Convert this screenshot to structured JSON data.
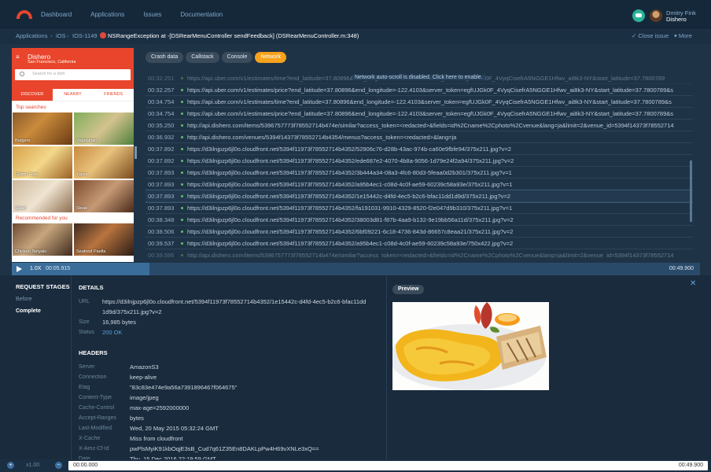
{
  "nav": {
    "links": [
      "Dashboard",
      "Applications",
      "Issues",
      "Documentation"
    ],
    "user_name": "Dmitry Fink",
    "user_org": "Dishero"
  },
  "breadcrumb": {
    "items": [
      "Applications",
      "iOS",
      "IOS-1149"
    ],
    "title": "NSRangeException at -[DSRearMenuController sendFeedback] (DSRearMenuController.m:348)",
    "close_issue": "✓ Close issue",
    "more": "▾ More"
  },
  "phone": {
    "app_title": "Dishero",
    "location": "San Francisco, California",
    "search_placeholder": "Search for a dish",
    "tabs": [
      "DISCOVER",
      "NEARBY",
      "FRIENDS"
    ],
    "section_top": "Top searches",
    "section_recommended": "Recommended for you",
    "tiles": [
      "Burgers",
      "Vegetarian",
      "Gluten Free",
      "Tacos",
      "Salad",
      "Steak",
      "Chicken Teriyaki",
      "Seafood Paella"
    ]
  },
  "player": {
    "speed": "1.0X",
    "current": "00:05.915",
    "end": "00:49.900",
    "progress": 0.2
  },
  "filters": [
    "Crash data",
    "Callstack",
    "Console",
    "Network"
  ],
  "log": {
    "notice": "Network auto-scroll is disabled. Click here to enable.",
    "rows": [
      {
        "time": "00:32.251",
        "url": "https://api.uber.com/v1/estimates/time?end_latitude=37.80896&end_longitude=-122.4103&server_token=egfUJGk0F_4VyqCisefrA5NGGE1Hfwv_ai8k3-NY&start_latitude=37.7800789"
      },
      {
        "time": "00:32.257",
        "url": "https://api.uber.com/v1/estimates/price?end_latitude=37.80896&end_longitude=-122.4103&server_token=egfUJGk0F_4VyqCisefrA5NGGE1Hfwv_ai8k3-NY&start_latitude=37.7800789&s"
      },
      {
        "time": "00:34.754",
        "url": "https://api.uber.com/v1/estimates/time?end_latitude=37.80896&end_longitude=-122.4103&server_token=egfUJGk0F_4VyqCisefrA5NGGE1Hfwv_ai8k3-NY&start_latitude=37.7800789&s"
      },
      {
        "time": "00:34.754",
        "url": "https://api.uber.com/v1/estimates/price?end_latitude=37.80896&end_longitude=-122.4103&server_token=egfUJGk0F_4VyqCisefrA5NGGE1Hfwv_ai8k3-NY&start_latitude=37.7800789&s"
      },
      {
        "time": "00:35.250",
        "url": "http://api.dishero.com/items/5396757773f78552714b474e/similar?access_token=<redacted>&fields=id%2Cname%2Cphoto%2Cvenue&lang=ja&limit=2&venue_id=5394f14373f78552714"
      },
      {
        "time": "00:36.932",
        "url": "http://api.dishero.com/venues/5394f14373f78552714b4354/menus?access_token=<redacted>&lang=ja"
      },
      {
        "time": "00:37.892",
        "url": "https://d3ilnjpzp6jl0o.cloudfront.net/5394f11973f78552714b4352/52906c76-d28b-43ac-974b-ca60e9fbfe94/375x211.jpg?v=2"
      },
      {
        "time": "00:37.892",
        "url": "https://d3ilnjpzp6jl0o.cloudfront.net/5394f11973f78552714b4352/ede687e2-4070-4b8a-9056-1d79e24f2a94/375x211.jpg?v=2"
      },
      {
        "time": "00:37.893",
        "url": "https://d3ilnjpzp6jl0o.cloudfront.net/5394f11973f78552714b4352/3b444a34-08a3-4fc6-80d3-5feaa0d2b301/375x211.jpg?v=1"
      },
      {
        "time": "00:37.893",
        "url": "https://d3ilnjpzp6jl0o.cloudfront.net/5394f11973f78552714b4352/a95b4ec1-c08d-4c0f-ae59-60239c58a93e/375x211.jpg?v=1"
      },
      {
        "time": "00:37.893",
        "url": "https://d3ilnjpzp6jl0o.cloudfront.net/5394f11973f78552714b4352/1e15442c-d4fd-4ec5-b2c6-bfac11dd1d9d/375x211.jpg?v=2",
        "selected": true
      },
      {
        "time": "00:37.893",
        "url": "https://d3ilnjpzp6jl0o.cloudfront.net/5394f11973f78552714b4352/fa191031-9910-4329-8520-f2e047d9b310/375x211.jpg?v=1"
      },
      {
        "time": "00:38.348",
        "url": "https://d3ilnjpzp6jl0o.cloudfront.net/5394f11973f78552714b4352/38003d81-f87b-4aa9-b132-9e19bb56a11d/375x211.jpg?v=2"
      },
      {
        "time": "00:38.506",
        "url": "https://d3ilnjpzp6jl0o.cloudfront.net/5394f11973f78552714b4352/6bf09221-6c18-4736-843d-86657c8eaa21/375x211.jpg?v=2"
      },
      {
        "time": "00:39.537",
        "url": "https://d3ilnjpzp6jl0o.cloudfront.net/5394f11973f78552714b4352/a95b4ec1-c08d-4c0f-ae59-60239c58a93e/750x422.jpg?v=2"
      },
      {
        "time": "00:39.595",
        "url": "http://api.dishero.com/items/5396757773f78552714b474e/similar?access_token=<redacted>&fields=id%2Cname%2Cphoto%2Cvenue&lang=ja&limit=2&venue_id=5394f14373f78552714"
      }
    ]
  },
  "details": {
    "stages_title": "REQUEST STAGES",
    "stages": [
      "Before",
      "Complete"
    ],
    "title": "DETAILS",
    "url_label": "URL",
    "url_line1": "https://d3ilnjpzp6jl0o.cloudfront.net/5394f11973f78552714b4352/1e15442c-d4fd-4ec5-b2c6-bfac11dd",
    "url_line2": "1d9d/375x211.jpg?v=2",
    "size_label": "Size",
    "size": "16,985 bytes",
    "status_label": "Status",
    "status": "200 OK",
    "headers_title": "HEADERS",
    "headers": [
      {
        "k": "Server",
        "v": "AmazonS3"
      },
      {
        "k": "Connection",
        "v": "keep-alive"
      },
      {
        "k": "Etag",
        "v": "\"83c83e474e9a56a7391896467f064675\""
      },
      {
        "k": "Content-Type",
        "v": "image/jpeg"
      },
      {
        "k": "Cache-Control",
        "v": "max-age=2592000000"
      },
      {
        "k": "Accept-Ranges",
        "v": "bytes"
      },
      {
        "k": "Last-Modified",
        "v": "Wed, 20 May 2015 05:32:24 GMT"
      },
      {
        "k": "X-Cache",
        "v": "Miss from cloudfront"
      },
      {
        "k": "X-Amz-Cf-Id",
        "v": "pwPlsMyiK91kbOqjE3sB_Cud7q61Z35En8DAKLpPw4H69vXNLe3xQ=="
      },
      {
        "k": "Date",
        "v": "Thu, 15 Dec 2016 22:19:59 GMT"
      }
    ],
    "preview_label": "Preview",
    "close": "✕"
  },
  "bottom": {
    "zoom": "x1.00",
    "start": "00:00.000",
    "end": "00:49.900"
  },
  "colors": {
    "accent": "#f7a21b",
    "brand": "#e8452c",
    "background": "#1f3347"
  }
}
